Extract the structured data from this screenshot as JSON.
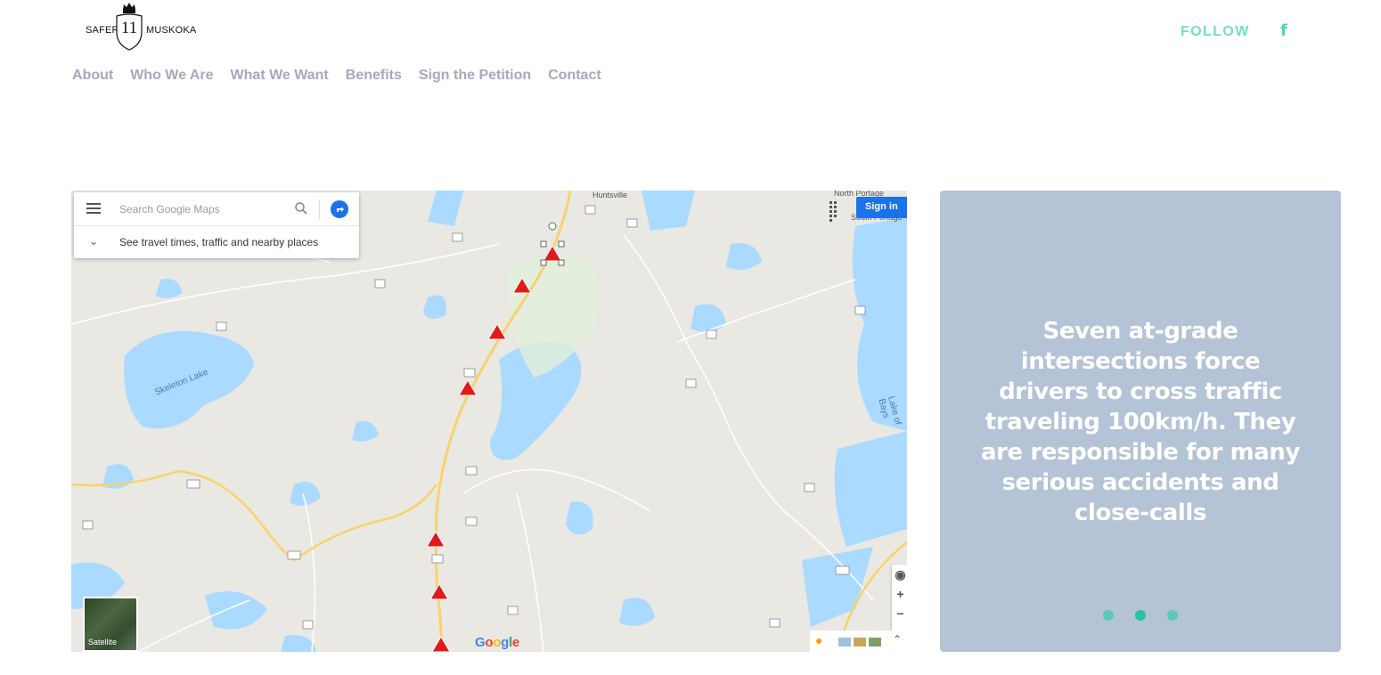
{
  "logo": {
    "left_text": "SAFER",
    "number": "11",
    "right_text": "MUSKOKA"
  },
  "header": {
    "follow_label": "FOLLOW",
    "facebook_icon": "f"
  },
  "nav": {
    "items": [
      {
        "label": "About"
      },
      {
        "label": "Who We Are"
      },
      {
        "label": "What We Want"
      },
      {
        "label": "Benefits"
      },
      {
        "label": "Sign the Petition"
      },
      {
        "label": "Contact"
      }
    ]
  },
  "map": {
    "search_placeholder": "Search Google Maps",
    "travel_text": "See travel times, traffic and nearby places",
    "sign_in": "Sign in",
    "satellite": "Satellite",
    "google": "Google",
    "zoom_in": "+",
    "zoom_out": "−",
    "labels": {
      "huntsville": "Huntsville",
      "north_portage": "North Portage",
      "south_portage": "South Portage",
      "skeleton_lake": "Skeleton Lake",
      "lake_of_bays": "Lake of Bays"
    },
    "markers": 7
  },
  "slider": {
    "quote": "Seven at-grade intersections force drivers to cross traffic traveling 100km/h. They are responsible for many serious accidents and close-calls",
    "dots": 3,
    "active_dot": 2
  },
  "colors": {
    "accent": "#4fd7b6",
    "nav": "#a5a9bd",
    "panel": "#b4c3d6"
  }
}
